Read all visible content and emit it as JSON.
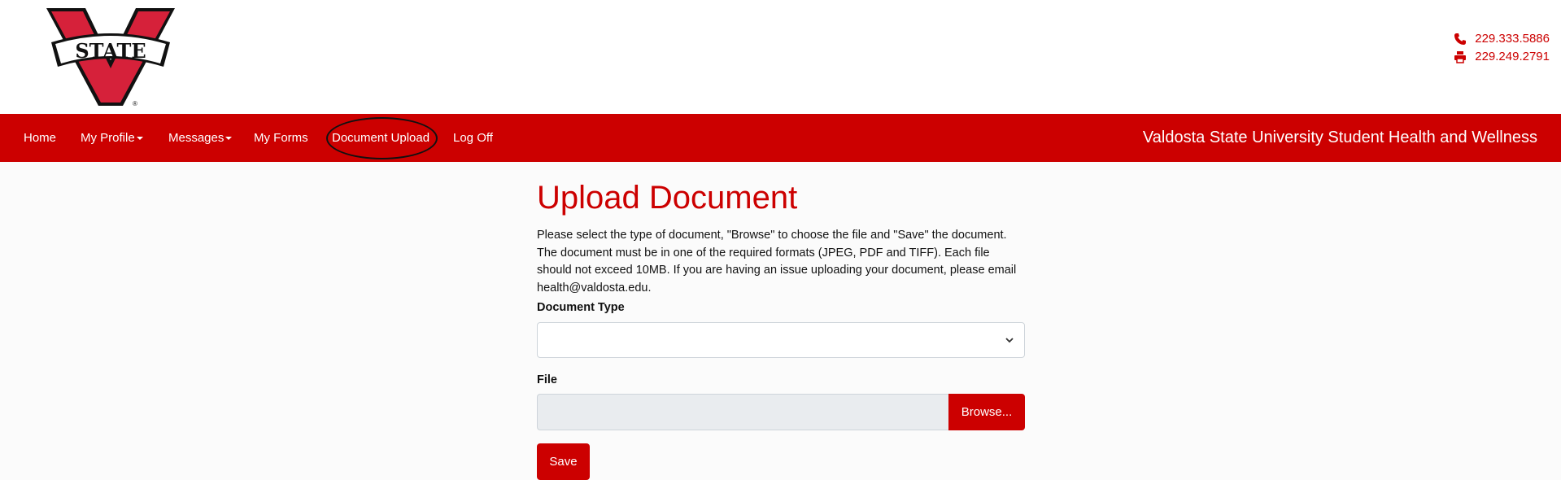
{
  "header": {
    "logo_text": "STATE",
    "logo_letter": "V",
    "phone": "229.333.5886",
    "fax": "229.249.2791"
  },
  "nav": {
    "items": [
      {
        "label": "Home"
      },
      {
        "label": "My Profile"
      },
      {
        "label": "Messages"
      },
      {
        "label": "My Forms"
      },
      {
        "label": "Document Upload"
      },
      {
        "label": "Log Off"
      }
    ],
    "brand": "Valdosta State University Student Health and Wellness"
  },
  "main": {
    "title": "Upload Document",
    "intro": "Please select the type of document, \"Browse\" to choose the file and \"Save\" the document. The document must be in one of the required formats (JPEG, PDF and TIFF). Each file should not exceed 10MB. If you are having an issue uploading your document, please email health@valdosta.edu.",
    "document_type_label": "Document Type",
    "document_type_value": "",
    "file_label": "File",
    "browse_label": "Browse...",
    "save_label": "Save"
  },
  "colors": {
    "brand_red": "#cc0000",
    "input_bg": "#e9ecef"
  },
  "icons": {
    "phone": "phone-icon",
    "fax": "printer-icon",
    "select": "chevron-down-icon"
  }
}
